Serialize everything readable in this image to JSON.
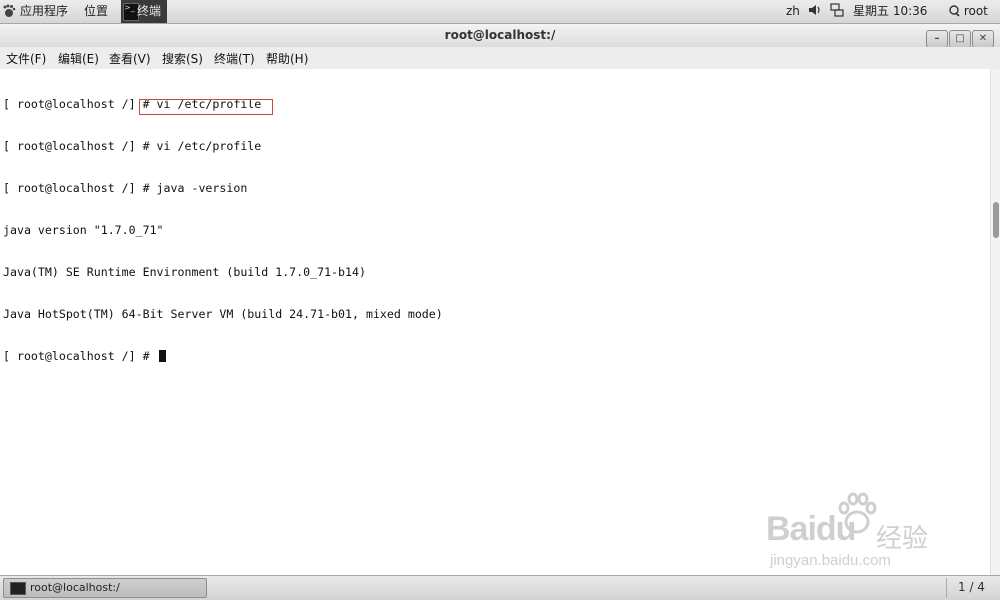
{
  "top_panel": {
    "applications": "应用程序",
    "places": "位置",
    "terminal_task": "终端",
    "language": "zh",
    "clock": "星期五 10:36",
    "user": "root"
  },
  "window": {
    "title": "root@localhost:/"
  },
  "menu": [
    "文件(F)",
    "编辑(E)",
    "查看(V)",
    "搜索(S)",
    "终端(T)",
    "帮助(H)"
  ],
  "terminal": {
    "lines": [
      "[ root@localhost /] # vi /etc/profile",
      "[ root@localhost /] # vi /etc/profile",
      "[ root@localhost /] # java -version",
      "java version \"1.7.0_71\"",
      "Java(TM) SE Runtime Environment (build 1.7.0_71-b14)",
      "Java HotSpot(TM) 64-Bit Server VM (build 24.71-b01, mixed mode)",
      "[ root@localhost /] # "
    ]
  },
  "watermark": {
    "logo": "Baidu",
    "logo_suffix": "经验",
    "url": "jingyan.baidu.com"
  },
  "bottom_panel": {
    "task_label": "root@localhost:/",
    "workspace": "1 / 4"
  },
  "colors": {
    "highlight_box": "#cc4444",
    "terminal_bg": "#ffffff",
    "terminal_fg": "#111111"
  }
}
